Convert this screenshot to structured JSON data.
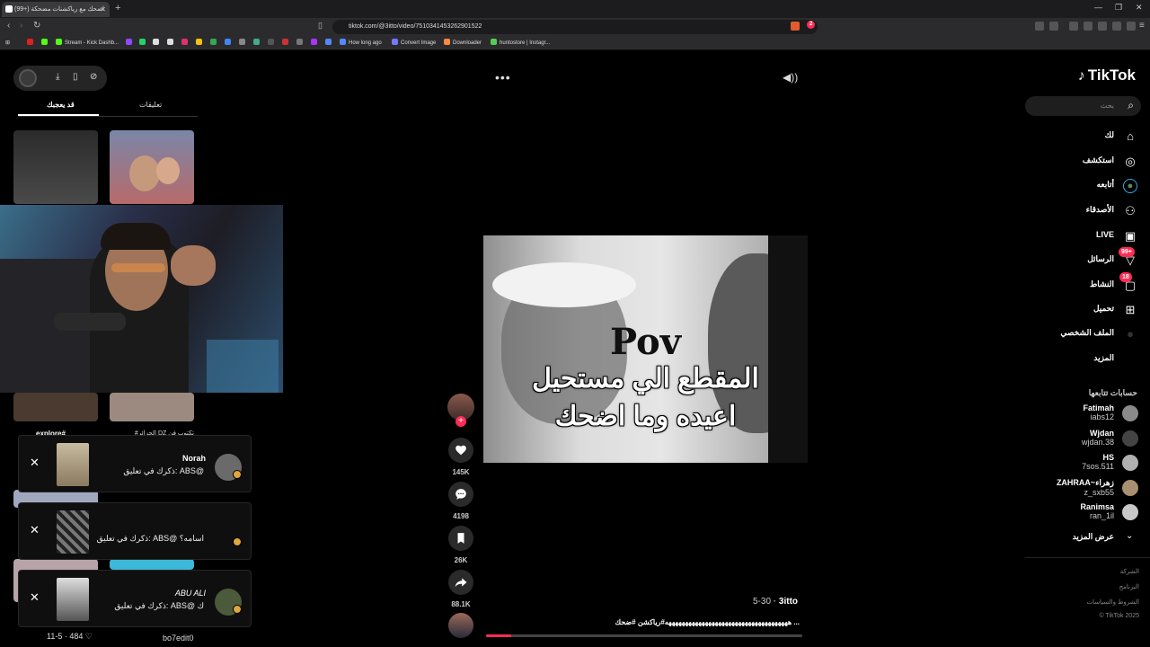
{
  "browser": {
    "tab_title": "(99+) اضحك مع رياكشنات مضحكة",
    "url": "tiktok.com/@3itto/video/7510341453262901522",
    "bookmarks": [
      "Stream - Kick Dashb...",
      "How long ago",
      "Convert Image",
      "Downloader",
      "huntostore | Instagr..."
    ],
    "ext_badge": "2"
  },
  "left_panel": {
    "tabs": [
      "تعليقات",
      "قد يعجبك"
    ],
    "active_tab": "قد يعجبك",
    "grid_captions": [
      "explore#",
      "#الحزائر DZ تكتوب فن"
    ],
    "bottom_left_stats": "11-5 · 484 ♡",
    "bottom_right_user": "bo7edit0"
  },
  "notifications": [
    {
      "name": "Norah",
      "message": "ذكرك في تعليق: ABS@"
    },
    {
      "name": "",
      "message": "ذكرك في تعليق: ABS@ اسامه؟"
    },
    {
      "name": "ABU ALI",
      "message": "ذكرك في تعليق: ABS@ ك"
    }
  ],
  "video": {
    "pov_text": "Pov",
    "caption_line1": "المقطع الي مستحيل",
    "caption_line2": "اعيده وما اضحك",
    "author": "3itto",
    "date": "5-30",
    "description": "هههههههههههههههههههههههههههههههههههههه#رياكشن #ضحك ...",
    "progress": 0.08
  },
  "actions": {
    "likes": "145K",
    "comments": "4198",
    "saves": "26K",
    "shares": "88.1K"
  },
  "sidebar": {
    "logo": "TikTok",
    "search_placeholder": "بحث",
    "nav": [
      {
        "label": "لك",
        "icon": "home-icon"
      },
      {
        "label": "استكشف",
        "icon": "compass-icon"
      },
      {
        "label": "أتابعه",
        "icon": "following-avatar-icon"
      },
      {
        "label": "الأصدقاء",
        "icon": "friends-icon"
      },
      {
        "label": "LIVE",
        "icon": "live-icon"
      },
      {
        "label": "الرسائل",
        "icon": "messages-icon",
        "badge": "99+"
      },
      {
        "label": "النشاط",
        "icon": "activity-icon",
        "badge": "18"
      },
      {
        "label": "تحميل",
        "icon": "upload-icon"
      },
      {
        "label": "الملف الشخصي",
        "icon": "profile-icon"
      },
      {
        "label": "المزيد",
        "icon": "more-icon"
      }
    ],
    "following_header": "حسابات تتابعها",
    "following": [
      {
        "name": "Fatimah",
        "handle": "iabs12"
      },
      {
        "name": "Wjdan",
        "handle": "wjdan.38"
      },
      {
        "name": "HS",
        "handle": "7sos.511"
      },
      {
        "name": "ZAHRAA~زهراء",
        "handle": "z_sxb55"
      },
      {
        "name": "Ranimsa",
        "handle": "ran_1il"
      }
    ],
    "see_more": "عرض المزيد",
    "footer": [
      "الشركة",
      "البرنامج",
      "الشروط والسياسات",
      "© TikTok 2025"
    ]
  }
}
